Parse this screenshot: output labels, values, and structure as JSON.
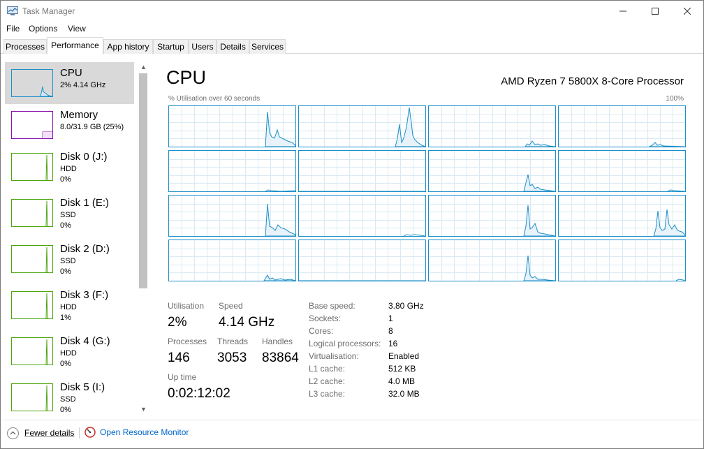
{
  "window": {
    "title": "Task Manager",
    "accent": "#1a8fc9"
  },
  "menu": [
    "File",
    "Options",
    "View"
  ],
  "tabs": [
    "Processes",
    "Performance",
    "App history",
    "Startup",
    "Users",
    "Details",
    "Services"
  ],
  "active_tab": "Performance",
  "sidebar": {
    "items": [
      {
        "name": "CPU",
        "line1": "2% 4.14 GHz",
        "line2": "",
        "color": "#1a8fc9",
        "icon": "cpu-thumbnail"
      },
      {
        "name": "Memory",
        "line1": "8.0/31.9 GB (25%)",
        "line2": "",
        "color": "#8b12ae",
        "icon": "memory-thumbnail"
      },
      {
        "name": "Disk 0 (J:)",
        "line1": "HDD",
        "line2": "0%",
        "color": "#4da60c",
        "icon": "disk-thumbnail"
      },
      {
        "name": "Disk 1 (E:)",
        "line1": "SSD",
        "line2": "0%",
        "color": "#4da60c",
        "icon": "disk-thumbnail"
      },
      {
        "name": "Disk 2 (D:)",
        "line1": "SSD",
        "line2": "0%",
        "color": "#4da60c",
        "icon": "disk-thumbnail"
      },
      {
        "name": "Disk 3 (F:)",
        "line1": "HDD",
        "line2": "1%",
        "color": "#4da60c",
        "icon": "disk-thumbnail"
      },
      {
        "name": "Disk 4 (G:)",
        "line1": "HDD",
        "line2": "0%",
        "color": "#4da60c",
        "icon": "disk-thumbnail"
      },
      {
        "name": "Disk 5 (I:)",
        "line1": "SSD",
        "line2": "0%",
        "color": "#4da60c",
        "icon": "disk-thumbnail"
      }
    ]
  },
  "cpu": {
    "title": "CPU",
    "processor": "AMD Ryzen 7 5800X 8-Core Processor",
    "graph_caption": "% Utilisation over 60 seconds",
    "graph_max": "100%",
    "stats": {
      "utilisation_label": "Utilisation",
      "utilisation": "2%",
      "speed_label": "Speed",
      "speed": "4.14 GHz",
      "processes_label": "Processes",
      "processes": "146",
      "threads_label": "Threads",
      "threads": "3053",
      "handles_label": "Handles",
      "handles": "83864",
      "uptime_label": "Up time",
      "uptime": "0:02:12:02"
    },
    "specs": [
      {
        "label": "Base speed:",
        "value": "3.80 GHz"
      },
      {
        "label": "Sockets:",
        "value": "1"
      },
      {
        "label": "Cores:",
        "value": "8"
      },
      {
        "label": "Logical processors:",
        "value": "16"
      },
      {
        "label": "Virtualisation:",
        "value": "Enabled"
      },
      {
        "label": "L1 cache:",
        "value": "512 KB"
      },
      {
        "label": "L2 cache:",
        "value": "4.0 MB"
      },
      {
        "label": "L3 cache:",
        "value": "32.0 MB"
      }
    ]
  },
  "footer": {
    "fewer_details": "Fewer details",
    "open_resource_monitor": "Open Resource Monitor"
  }
}
